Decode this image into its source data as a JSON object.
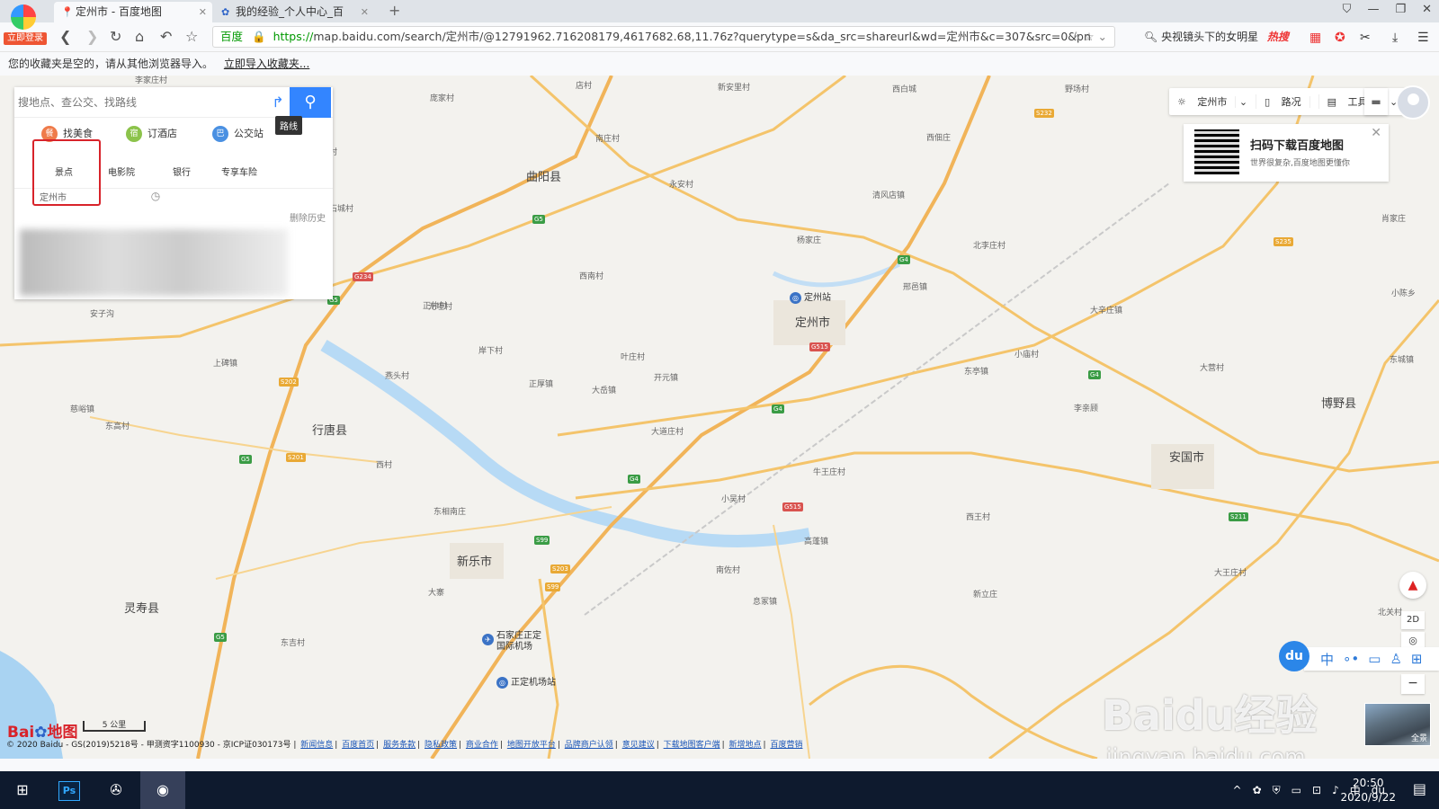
{
  "browser": {
    "login_badge": "立即登录",
    "tabs": [
      {
        "label": "定州市 - 百度地图",
        "icon": "map-pin-icon"
      },
      {
        "label": "我的经验_个人中心_百",
        "icon": "baidu-paw-icon"
      }
    ],
    "url_site": "百度",
    "url_secure": "https://",
    "url_rest": "map.baidu.com/search/定州市/@12791962.716208179,4617682.68,11.76z?querytype=s&da_src=shareurl&wd=定州市&c=307&src=0&pn",
    "search_hint": "央视镜头下的女明星",
    "search_hot": "热搜",
    "bookmarks_text": "您的收藏夹是空的，请从其他浏览器导入。",
    "bookmarks_link": "立即导入收藏夹..."
  },
  "panel": {
    "search_placeholder": "搜地点、查公交、找路线",
    "route_tip": "路线",
    "quick": [
      {
        "label": "找美食",
        "color": "#ef7b4a"
      },
      {
        "label": "订酒店",
        "color": "#8cc34b"
      },
      {
        "label": "公交站",
        "color": "#4a90e2"
      }
    ],
    "categories": [
      "景点",
      "电影院",
      "银行",
      "专享车险"
    ],
    "history_item": "定州市",
    "delete_history": "删除历史"
  },
  "map_controls": {
    "city": "定州市",
    "traffic": "路况",
    "toolbox": "工具箱",
    "qr_title": "扫码下载百度地图",
    "qr_sub": "世界很复杂,百度地图更懂你",
    "mode_2d": "2D",
    "du": "du",
    "du_lang": "中",
    "panorama": "全景",
    "scale": "5 公里",
    "logo_a": "Bai",
    "logo_b": "地图"
  },
  "counties": [
    {
      "name": "曲阳县"
    },
    {
      "name": "定州市"
    },
    {
      "name": "行唐县"
    },
    {
      "name": "新乐市"
    },
    {
      "name": "灵寿县"
    },
    {
      "name": "安国市"
    },
    {
      "name": "博野县"
    }
  ],
  "places": [
    "李家庄村",
    "店村",
    "南庄村",
    "庞家村",
    "西佃庄",
    "野场村",
    "新安里村",
    "永安村",
    "小川村",
    "石城村",
    "西南村",
    "正仲村",
    "元坦村",
    "岸下村",
    "燕头村",
    "正厚镇",
    "大岳镇",
    "开元镇",
    "叶庄村",
    "黑山",
    "南王村",
    "上碑镇",
    "安子沟",
    "慈峪镇",
    "东高村",
    "牛王庄村",
    "高蓬镇",
    "大道庄村",
    "小吴村",
    "西王村",
    "东亭镇",
    "新立庄",
    "北李庄村",
    "杨家庄",
    "大辛庄镇",
    "清风店镇",
    "李亲顾",
    "邢邑镇",
    "息冢镇",
    "大寨",
    "南佐村",
    "东吉村",
    "西村",
    "东相南庄",
    "西白城",
    "小庙村",
    "大营村",
    "东城镇",
    "小陈乡",
    "大王庄村",
    "肖家庄",
    "北关村"
  ],
  "shields": [
    {
      "label": "G5",
      "c": "sg"
    },
    {
      "label": "G4",
      "c": "sg"
    },
    {
      "label": "G4",
      "c": "sg"
    },
    {
      "label": "G4",
      "c": "sg"
    },
    {
      "label": "S232",
      "c": "so"
    },
    {
      "label": "G234",
      "c": "sr"
    },
    {
      "label": "G5",
      "c": "sg"
    },
    {
      "label": "S202",
      "c": "so"
    },
    {
      "label": "S201",
      "c": "so"
    },
    {
      "label": "G5",
      "c": "sg"
    },
    {
      "label": "G515",
      "c": "sr"
    },
    {
      "label": "G515",
      "c": "sr"
    },
    {
      "label": "S99",
      "c": "sg"
    },
    {
      "label": "S203",
      "c": "so"
    },
    {
      "label": "G5",
      "c": "sg"
    },
    {
      "label": "S99",
      "c": "so"
    },
    {
      "label": "S235",
      "c": "so"
    },
    {
      "label": "S211",
      "c": "sg"
    },
    {
      "label": "G4",
      "c": "sg"
    }
  ],
  "pois": [
    {
      "label": "定州站"
    },
    {
      "label": "石家庄正定\n国际机场"
    },
    {
      "label": "正定机场站"
    }
  ],
  "footer": {
    "copyright": "© 2020 Baidu - GS(2019)5218号 - 甲测资字1100930 - 京ICP证030173号",
    "links": [
      "新闻信息",
      "百度首页",
      "服务条款",
      "隐私政策",
      "商业合作",
      "地图开放平台",
      "品牌商户认领",
      "意见建议",
      "下载地图客户端",
      "新增地点",
      "百度营销"
    ]
  },
  "watermark": {
    "main": "Baidu经验",
    "sub": "jingyan.baidu.com"
  },
  "taskbar": {
    "time": "20:50",
    "date": "2020/9/22",
    "ime": "中"
  }
}
